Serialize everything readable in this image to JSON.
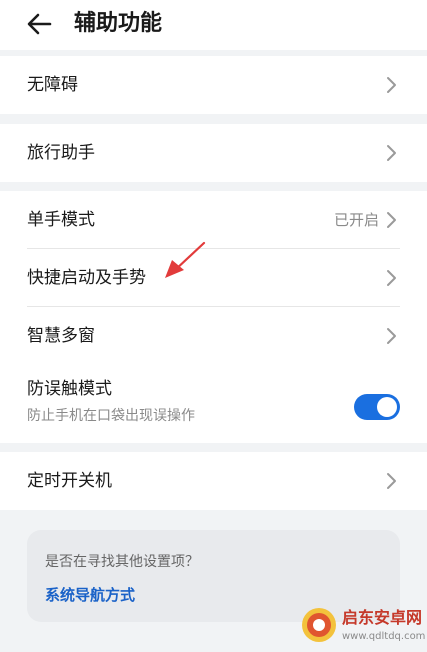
{
  "header": {
    "title": "辅助功能",
    "back_icon": "arrow-left-icon"
  },
  "sections": {
    "accessibility": {
      "label": "无障碍"
    },
    "travel": {
      "label": "旅行助手"
    },
    "one_hand": {
      "label": "单手模式",
      "value": "已开启"
    },
    "gestures": {
      "label": "快捷启动及手势"
    },
    "smart_window": {
      "label": "智慧多窗"
    },
    "mistouch": {
      "label": "防误触模式",
      "sub": "防止手机在口袋出现误操作",
      "enabled": true
    },
    "schedule": {
      "label": "定时开关机"
    }
  },
  "suggest": {
    "question": "是否在寻找其他设置项？",
    "link": "系统导航方式"
  },
  "watermark": {
    "title": "启东安卓网",
    "url": "www.qdltdq.com"
  },
  "colors": {
    "accent": "#1a6fe0",
    "link": "#1a62c8",
    "arrow": "#e23b3b"
  }
}
